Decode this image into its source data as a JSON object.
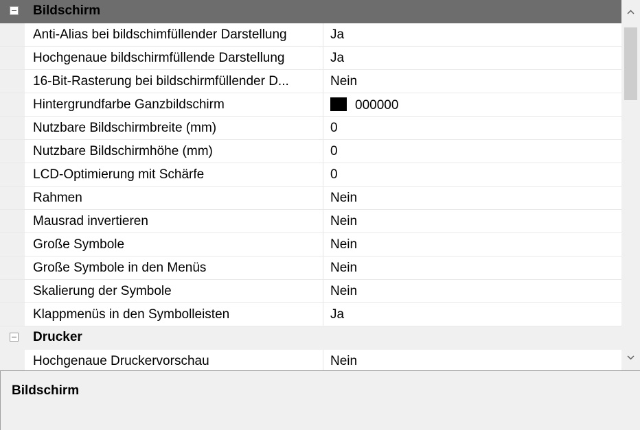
{
  "categories": [
    {
      "label": "Bildschirm",
      "rows": [
        {
          "name": "Anti-Alias bei bildschimfüllender Darstellung",
          "value": "Ja"
        },
        {
          "name": "Hochgenaue bildschirmfüllende Darstellung",
          "value": "Ja"
        },
        {
          "name": "16-Bit-Rasterung bei bildschirmfüllender D...",
          "value": "Nein"
        },
        {
          "name": "Hintergrundfarbe Ganzbildschirm",
          "value": "000000",
          "swatch_color": "#000000"
        },
        {
          "name": "Nutzbare Bildschirmbreite (mm)",
          "value": "0"
        },
        {
          "name": "Nutzbare Bildschirmhöhe (mm)",
          "value": "0"
        },
        {
          "name": "LCD-Optimierung mit Schärfe",
          "value": "0"
        },
        {
          "name": "Rahmen",
          "value": "Nein"
        },
        {
          "name": "Mausrad invertieren",
          "value": "Nein"
        },
        {
          "name": "Große Symbole",
          "value": "Nein"
        },
        {
          "name": "Große Symbole in den Menüs",
          "value": "Nein"
        },
        {
          "name": "Skalierung der Symbole",
          "value": "Nein"
        },
        {
          "name": "Klappmenüs in den Symbolleisten",
          "value": "Ja"
        }
      ]
    },
    {
      "label": "Drucker",
      "rows": [
        {
          "name": "Hochgenaue Druckervorschau",
          "value": "Nein"
        }
      ]
    }
  ],
  "help": {
    "title": "Bildschirm"
  },
  "colors": {
    "selected_category": "#6d6d6d",
    "gutter": "#f0f0f0",
    "grid_line": "#e4e4e4"
  }
}
